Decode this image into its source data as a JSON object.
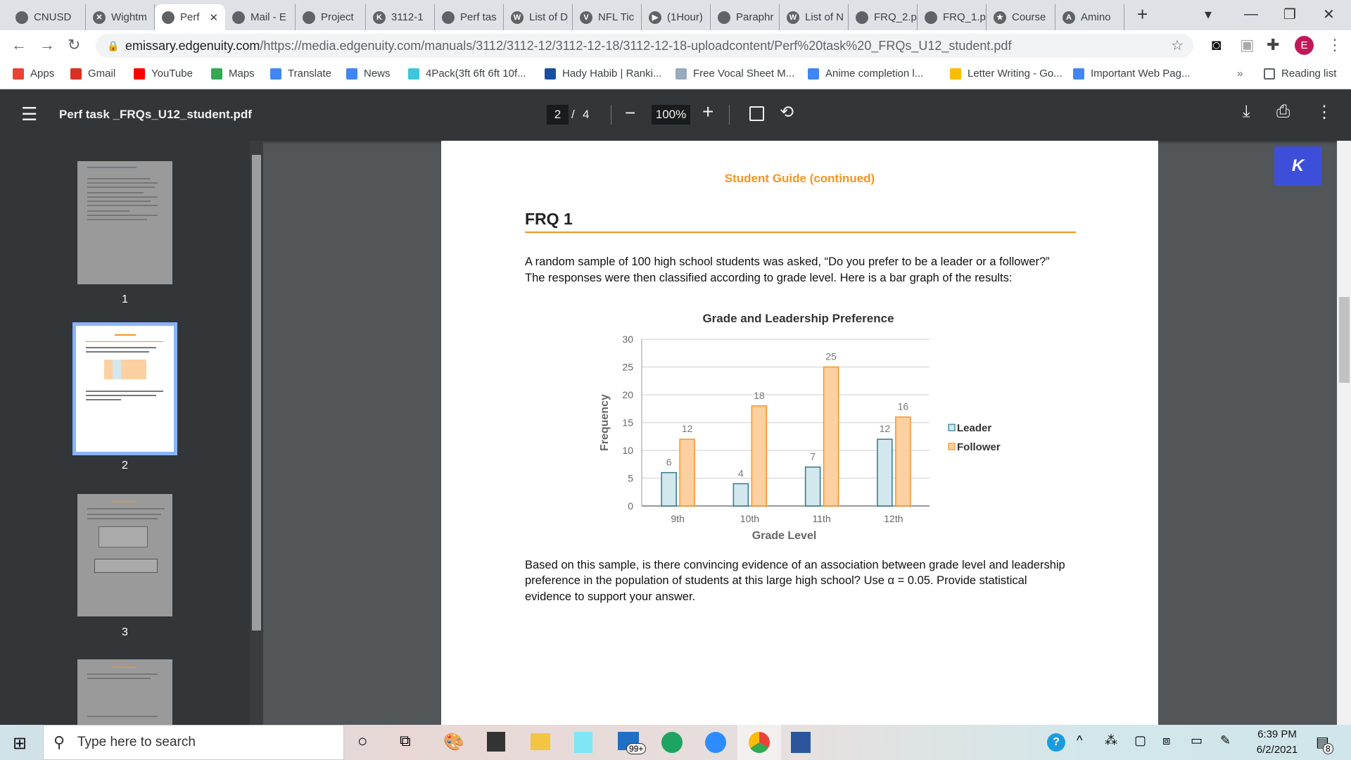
{
  "browser": {
    "tabs": [
      {
        "label": "CNUSD"
      },
      {
        "label": "Wightm"
      },
      {
        "label": "Perf"
      },
      {
        "label": "Mail - E"
      },
      {
        "label": "Project"
      },
      {
        "label": "3112-1"
      },
      {
        "label": "Perf tas"
      },
      {
        "label": "List of D"
      },
      {
        "label": "NFL Tic"
      },
      {
        "label": "(1Hour)"
      },
      {
        "label": "Paraphr"
      },
      {
        "label": "List of N"
      },
      {
        "label": "FRQ_2.p"
      },
      {
        "label": "FRQ_1.p"
      },
      {
        "label": "Course"
      },
      {
        "label": "Amino"
      }
    ],
    "url_host": "emissary.edgenuity.com",
    "url_path": "/https://media.edgenuity.com/manuals/3112/3112-12/3112-12-18/3112-12-18-uploadcontent/Perf%20task%20_FRQs_U12_student.pdf",
    "profile_initial": "E",
    "bookmarks": [
      {
        "label": "Apps",
        "color": "#ea4335"
      },
      {
        "label": "Gmail",
        "color": "#d93025"
      },
      {
        "label": "YouTube",
        "color": "#ff0000"
      },
      {
        "label": "Maps",
        "color": "#34a853"
      },
      {
        "label": "Translate",
        "color": "#4285f4"
      },
      {
        "label": "News",
        "color": "#4285f4"
      },
      {
        "label": "4Pack(3ft 6ft 6ft 10f...",
        "color": "#3ec6d8"
      },
      {
        "label": "Hady Habib | Ranki...",
        "color": "#1a4fa0"
      },
      {
        "label": "Free Vocal Sheet M...",
        "color": "#9ab"
      },
      {
        "label": "Anime completion l...",
        "color": "#4285f4"
      },
      {
        "label": "Letter Writing - Go...",
        "color": "#fbbc04"
      },
      {
        "label": "Important Web Pag...",
        "color": "#4285f4"
      }
    ],
    "more_bookmarks": "»",
    "reading_list": "Reading list"
  },
  "viewer": {
    "title": "Perf task _FRQs_U12_student.pdf",
    "page_current": "2",
    "page_sep": "/",
    "page_total": "4",
    "zoom": "100%",
    "thumbnails": [
      {
        "label": "1"
      },
      {
        "label": "2"
      },
      {
        "label": "3"
      }
    ],
    "floating_button": "K"
  },
  "page": {
    "header": "Student Guide (continued)",
    "heading": "FRQ 1",
    "intro_1": "A random sample of 100 high school students was asked, “Do you prefer to be a leader or a follower?”",
    "intro_2": "The responses were then classified according to grade level. Here is a bar graph of the results:",
    "question_1": "Based on this sample, is there convincing evidence of an association between grade level and leadership",
    "question_2": "preference in the population of students at this large high school? Use α = 0.05. Provide statistical",
    "question_3": "evidence to support your answer.",
    "accent": "#f7941d"
  },
  "chart_data": {
    "type": "bar",
    "title": "Grade and Leadership Preference",
    "xlabel": "Grade Level",
    "ylabel": "Frequency",
    "categories": [
      "9th",
      "10th",
      "11th",
      "12th"
    ],
    "series": [
      {
        "name": "Leader",
        "values": [
          6,
          4,
          7,
          12
        ],
        "color": "#d2e8ee",
        "stroke": "#31788a"
      },
      {
        "name": "Follower",
        "values": [
          12,
          18,
          25,
          16
        ],
        "color": "#fdd0a2",
        "stroke": "#f7941d"
      }
    ],
    "ylim": [
      0,
      30
    ],
    "yticks": [
      "0",
      "5",
      "10",
      "15",
      "20",
      "25",
      "30"
    ],
    "grid": true,
    "legend": "right"
  },
  "taskbar": {
    "search_placeholder": "Type here to search",
    "mail_badge": "99+",
    "time": "6:39 PM",
    "date": "6/2/2021",
    "notif_count": "8"
  }
}
